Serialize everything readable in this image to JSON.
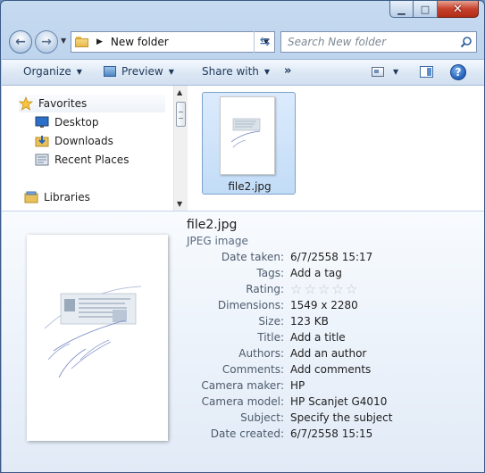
{
  "address": {
    "current_folder": "New folder"
  },
  "search": {
    "placeholder": "Search New folder"
  },
  "toolbar": {
    "organize_label": "Organize",
    "preview_label": "Preview",
    "share_label": "Share with",
    "more_label": "»"
  },
  "nav_pane": {
    "items": [
      {
        "label": "Favorites",
        "icon": "star-icon"
      },
      {
        "label": "Desktop",
        "icon": "desktop-icon"
      },
      {
        "label": "Downloads",
        "icon": "downloads-icon"
      },
      {
        "label": "Recent Places",
        "icon": "recent-places-icon"
      },
      {
        "label": "Libraries",
        "icon": "libraries-icon"
      }
    ]
  },
  "files": [
    {
      "name": "file2.jpg",
      "selected": true
    }
  ],
  "details": {
    "filename": "file2.jpg",
    "type": "JPEG image",
    "rating_stars": 0,
    "rating_max": 5,
    "properties": [
      {
        "label": "Date taken:",
        "value": "6/7/2558 15:17"
      },
      {
        "label": "Tags:",
        "value": "Add a tag"
      },
      {
        "label": "Rating:",
        "value": ""
      },
      {
        "label": "Dimensions:",
        "value": "1549 x 2280"
      },
      {
        "label": "Size:",
        "value": "123 KB"
      },
      {
        "label": "Title:",
        "value": "Add a title"
      },
      {
        "label": "Authors:",
        "value": "Add an author"
      },
      {
        "label": "Comments:",
        "value": "Add comments"
      },
      {
        "label": "Camera maker:",
        "value": "HP"
      },
      {
        "label": "Camera model:",
        "value": "HP Scanjet G4010"
      },
      {
        "label": "Subject:",
        "value": "Specify the subject"
      },
      {
        "label": "Date created:",
        "value": "6/7/2558 15:15"
      }
    ]
  },
  "colors": {
    "selection": "#cce1f8",
    "accent": "#3f6fb3"
  }
}
